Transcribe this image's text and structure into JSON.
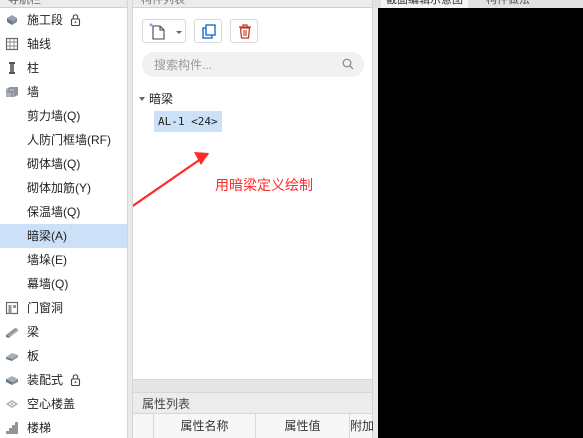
{
  "nav": {
    "header": "导航栏",
    "items": [
      {
        "label": "施工段",
        "icon": "construction-section-icon",
        "level": "cat",
        "locked": true
      },
      {
        "label": "轴线",
        "icon": "grid-axis-icon",
        "level": "cat",
        "locked": false
      },
      {
        "label": "柱",
        "icon": "column-icon",
        "level": "cat",
        "locked": false
      },
      {
        "label": "墙",
        "icon": "wall-icon",
        "level": "cat",
        "locked": false
      },
      {
        "label": "剪力墙(Q)",
        "level": "sub"
      },
      {
        "label": "人防门框墙(RF)",
        "level": "sub"
      },
      {
        "label": "砌体墙(Q)",
        "level": "sub"
      },
      {
        "label": "砌体加筋(Y)",
        "level": "sub"
      },
      {
        "label": "保温墙(Q)",
        "level": "sub"
      },
      {
        "label": "暗梁(A)",
        "level": "sub",
        "selected": true
      },
      {
        "label": "墙垛(E)",
        "level": "sub"
      },
      {
        "label": "幕墙(Q)",
        "level": "sub"
      },
      {
        "label": "门窗洞",
        "icon": "door-window-icon",
        "level": "cat",
        "locked": false
      },
      {
        "label": "梁",
        "icon": "beam-icon",
        "level": "cat",
        "locked": false
      },
      {
        "label": "板",
        "icon": "slab-icon",
        "level": "cat",
        "locked": false
      },
      {
        "label": "装配式",
        "icon": "prefab-icon",
        "level": "cat",
        "locked": true
      },
      {
        "label": "空心楼盖",
        "icon": "hollow-floor-icon",
        "level": "cat",
        "locked": false
      },
      {
        "label": "楼梯",
        "icon": "stair-icon",
        "level": "cat",
        "locked": false
      }
    ]
  },
  "component_list": {
    "header": "构件列表",
    "search_placeholder": "搜索构件...",
    "group": "暗梁",
    "component": "AL-1 <24>",
    "annotation": "用暗梁定义绘制",
    "annotation_color": "#ff2a2a"
  },
  "properties": {
    "title": "属性列表",
    "columns": [
      "属性名称",
      "属性值",
      "附加"
    ]
  },
  "right_tabs": [
    "截面编辑示意图",
    "构件做法"
  ],
  "colors": {
    "selected_bg": "#cce0f7",
    "canvas_bg": "#000000"
  }
}
